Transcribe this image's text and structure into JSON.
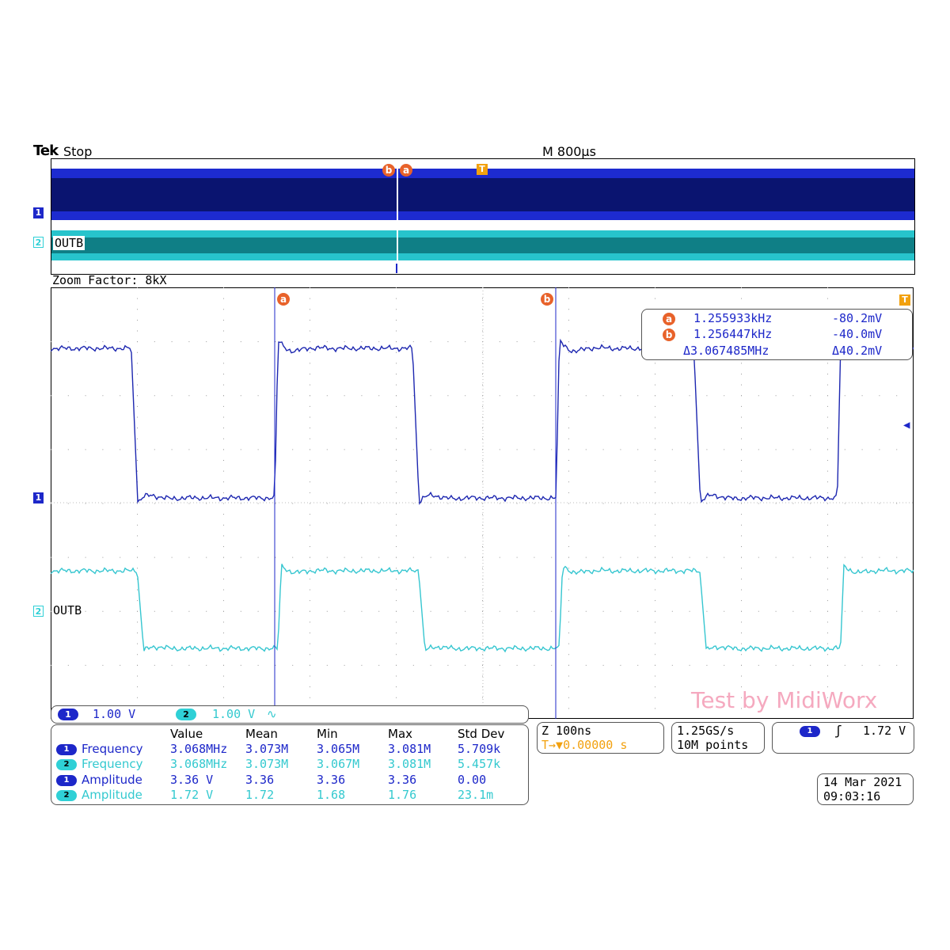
{
  "header": {
    "brand": "Tek",
    "acq_state": "Stop",
    "timebase": "M 800µs"
  },
  "overview": {
    "ch1_marker": "1",
    "ch2_marker": "2",
    "ch2_label": "OUTB",
    "cursor_b": "b",
    "cursor_a": "a",
    "trigger_marker": "T",
    "ch1_color": "#0a1f8f",
    "ch2_color": "#138f96"
  },
  "zoom": {
    "factor_label": "Zoom Factor: 8kX",
    "cursor_a_label": "a",
    "cursor_b_label": "b",
    "trigger_marker": "T",
    "ch1_marker": "1",
    "ch2_marker": "2",
    "ch2_label": "OUTB"
  },
  "cursor_readout": {
    "a_badge": "a",
    "a_freq": "1.255933kHz",
    "a_volt": "-80.2mV",
    "b_badge": "b",
    "b_freq": "1.256447kHz",
    "b_volt": "-40.0mV",
    "delta_freq": "Δ3.067485MHz",
    "delta_volt": "Δ40.2mV"
  },
  "scale": {
    "ch1_badge": "1",
    "ch1_scale": "1.00 V",
    "ch2_badge": "2",
    "ch2_scale": "1.00 V",
    "ch2_coupling_symbol": "∿"
  },
  "measurements": {
    "headers": [
      "Value",
      "Mean",
      "Min",
      "Max",
      "Std Dev"
    ],
    "rows": [
      {
        "badge": "1",
        "name": "Frequency",
        "value": "3.068MHz",
        "mean": "3.073M",
        "min": "3.065M",
        "max": "3.081M",
        "std": "5.709k"
      },
      {
        "badge": "2",
        "name": "Frequency",
        "value": "3.068MHz",
        "mean": "3.073M",
        "min": "3.067M",
        "max": "3.081M",
        "std": "5.457k"
      },
      {
        "badge": "1",
        "name": "Amplitude",
        "value": "3.36 V",
        "mean": "3.36",
        "min": "3.36",
        "max": "3.36",
        "std": "0.00"
      },
      {
        "badge": "2",
        "name": "Amplitude",
        "value": "1.72 V",
        "mean": "1.72",
        "min": "1.68",
        "max": "1.76",
        "std": "23.1m"
      }
    ]
  },
  "zoom_panel": {
    "zoom_timebase": "Z 100ns",
    "trigger_pos": "T→▼0.00000 s"
  },
  "rate_panel": {
    "sample_rate": "1.25GS/s",
    "record_length": "10M points"
  },
  "trigger_panel": {
    "badge": "1",
    "slope_symbol": "ʃ",
    "level": "1.72 V"
  },
  "date_panel": {
    "date": "14 Mar 2021",
    "time": "09:03:16"
  },
  "watermark": "Test by MidiWorx",
  "waveform": {
    "period_divs": 3.26,
    "ch1_amplitude_v": 3.36,
    "ch2_amplitude_v": 1.72,
    "ch1_color": "#1d27b0",
    "ch2_color": "#36c6d0"
  }
}
